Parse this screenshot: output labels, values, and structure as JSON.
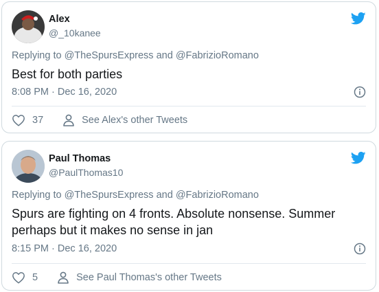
{
  "tweets": [
    {
      "name": "Alex",
      "handle": "@_10kanee",
      "replying_prefix": "Replying to",
      "reply_to_1": "@TheSpursExpress",
      "reply_and": "and",
      "reply_to_2": "@FabrizioRomano",
      "text": "Best for both parties",
      "time": "8:08 PM · Dec 16, 2020",
      "likes": "37",
      "other_tweets": "See Alex's other Tweets"
    },
    {
      "name": "Paul Thomas",
      "handle": "@PaulThomas10",
      "replying_prefix": "Replying to",
      "reply_to_1": "@TheSpursExpress",
      "reply_and": "and",
      "reply_to_2": "@FabrizioRomano",
      "text": "Spurs are fighting on 4 fronts. Absolute nonsense. Summer perhaps but it makes no sense in jan",
      "time": "8:15 PM · Dec 16, 2020",
      "likes": "5",
      "other_tweets": "See Paul Thomas's other Tweets"
    }
  ],
  "icons": {
    "brand": "twitter-bird-icon",
    "info": "info-icon",
    "like": "heart-icon",
    "profile": "person-icon"
  },
  "colors": {
    "twitter_blue": "#1da1f2",
    "secondary_text": "#657786",
    "border": "#cfd9de"
  }
}
